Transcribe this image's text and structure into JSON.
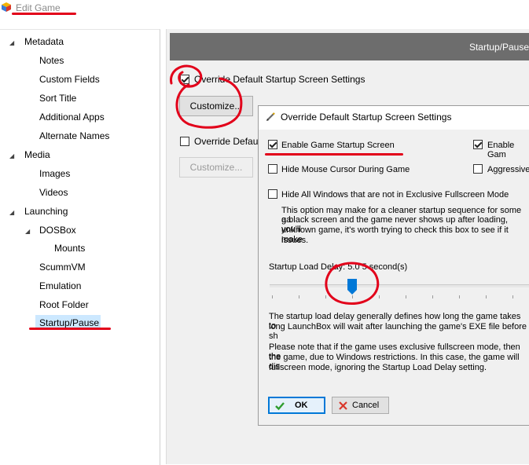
{
  "window": {
    "title": "Edit Game"
  },
  "tree": {
    "items": [
      {
        "label": "Metadata",
        "expander": "expanded"
      },
      {
        "label": "Notes"
      },
      {
        "label": "Custom Fields"
      },
      {
        "label": "Sort Title"
      },
      {
        "label": "Additional Apps"
      },
      {
        "label": "Alternate Names"
      },
      {
        "label": "Media",
        "expander": "expanded"
      },
      {
        "label": "Images"
      },
      {
        "label": "Videos"
      },
      {
        "label": "Launching",
        "expander": "expanded"
      },
      {
        "label": "DOSBox",
        "expander": "expanded"
      },
      {
        "label": "Mounts"
      },
      {
        "label": "ScummVM"
      },
      {
        "label": "Emulation"
      },
      {
        "label": "Root Folder"
      },
      {
        "label": "Startup/Pause",
        "selected": true
      }
    ]
  },
  "panel": {
    "header": "Startup/Pause",
    "override_startup": {
      "label": "Override Default Startup Screen Settings",
      "checked": true
    },
    "customize_label": "Customize...",
    "override_pause": {
      "label": "Override Defau",
      "checked": false
    },
    "customize2_label": "Customize..."
  },
  "dialog": {
    "title": "Override Default Startup Screen Settings",
    "enable_startup": {
      "label": "Enable Game Startup Screen",
      "checked": true
    },
    "enable_right": {
      "label": "Enable Gam",
      "checked": true
    },
    "hide_mouse": {
      "label": "Hide Mouse Cursor During Game",
      "checked": false
    },
    "aggressive": {
      "label": "Aggressive",
      "checked": false
    },
    "hide_windows": {
      "label": "Hide All Windows that are not in Exclusive Fullscreen Mode",
      "checked": false
    },
    "info_lines": [
      "This option may make for a cleaner startup sequence for some ga",
      "a black screen and the game never shows up after loading, you'll",
      "unknown game, it's worth trying to check this box to see if it make",
      "issues."
    ],
    "delay_label": "Startup Load Delay: 5.0 5 second(s)",
    "delay_seconds": 5.05,
    "desc1_lines": [
      "The startup load delay generally defines how long the game takes to",
      "long LaunchBox will wait after launching the game's EXE file before sh"
    ],
    "desc2_lines": [
      "Please note that if the game uses exclusive fullscreen mode, then the",
      "the game, due to Windows restrictions. In this case, the game will dis",
      "fullscreen mode, ignoring the Startup Load Delay setting."
    ],
    "ok_label": "OK",
    "cancel_label": "Cancel"
  },
  "colors": {
    "annotation": "#e2001a",
    "selection": "#cce8ff",
    "header_bg": "#6d6d6d",
    "ok_border": "#0078d7"
  },
  "icons": {
    "app": "launchbox-cube-icon",
    "pencil": "pencil-icon",
    "ok": "checkmark-icon",
    "cancel": "x-icon"
  }
}
